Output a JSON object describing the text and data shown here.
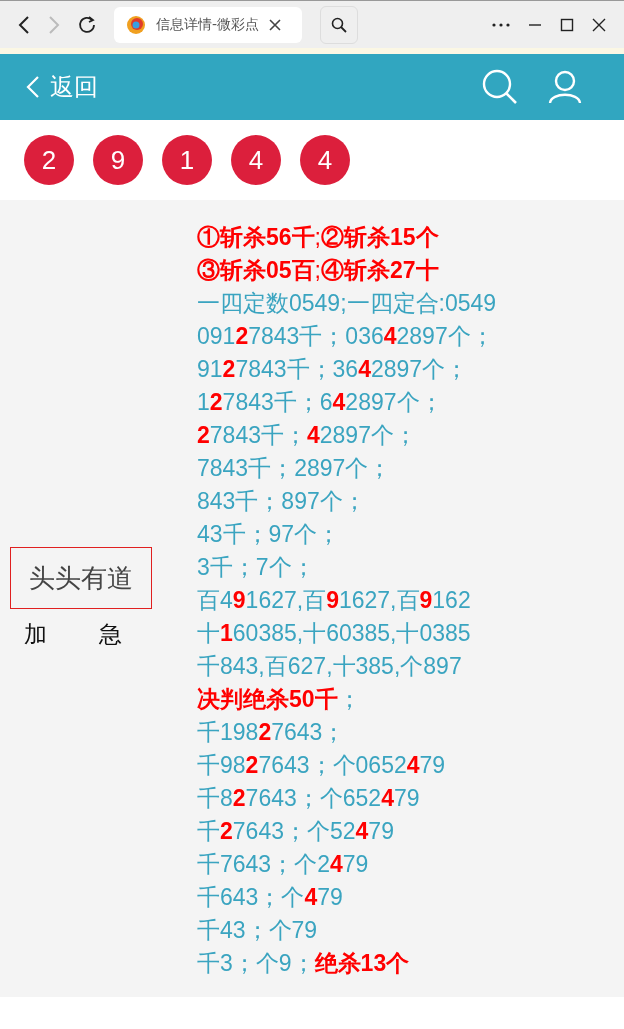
{
  "browser": {
    "back_enabled": true,
    "forward_enabled": false,
    "tab_title": "信息详情-微彩点"
  },
  "header": {
    "back_label": "返回"
  },
  "balls": [
    "2",
    "9",
    "1",
    "4",
    "4"
  ],
  "post": {
    "title": "头头有道",
    "urgent_marks": [
      "加",
      "急"
    ],
    "lines": [
      {
        "kind": "alert",
        "text": "**①斩杀56千**;**②斩杀15个**"
      },
      {
        "kind": "alert",
        "text": "**③斩杀05百**;**④斩杀27十**"
      },
      {
        "kind": "plain",
        "text": "一四定数0549;一四定合:0549"
      },
      {
        "kind": "plain",
        "text": "091**2**7843千；036**4**2897个；"
      },
      {
        "kind": "plain",
        "text": "91**2**7843千；36**4**2897个；"
      },
      {
        "kind": "plain",
        "text": "1**2**7843千；6**4**2897个；"
      },
      {
        "kind": "plain",
        "text": "**2**7843千；**4**2897个；"
      },
      {
        "kind": "plain",
        "text": "7843千；2897个；"
      },
      {
        "kind": "plain",
        "text": "843千；897个；"
      },
      {
        "kind": "plain",
        "text": "43千；97个；"
      },
      {
        "kind": "plain",
        "text": "3千；7个；"
      },
      {
        "kind": "plain",
        "text": "百4**9**1627,百**9**1627,百**9**162"
      },
      {
        "kind": "plain",
        "text": "十**1**60385,十60385,十0385"
      },
      {
        "kind": "plain",
        "text": "千843,百627,十385,个897"
      },
      {
        "kind": "plain",
        "text": "**决判绝杀50千**；"
      },
      {
        "kind": "plain",
        "text": "千198**2**7643；"
      },
      {
        "kind": "plain",
        "text": "千98**2**7643；个0652**4**79"
      },
      {
        "kind": "plain",
        "text": "千8**2**7643；个652**4**79"
      },
      {
        "kind": "plain",
        "text": "千**2**7643；个52**4**79"
      },
      {
        "kind": "plain",
        "text": "千7643；个2**4**79"
      },
      {
        "kind": "plain",
        "text": "千643；个**4**79"
      },
      {
        "kind": "plain",
        "text": "千43；个79"
      },
      {
        "kind": "plain",
        "text": "千3；个9；**绝杀13个**"
      }
    ]
  }
}
